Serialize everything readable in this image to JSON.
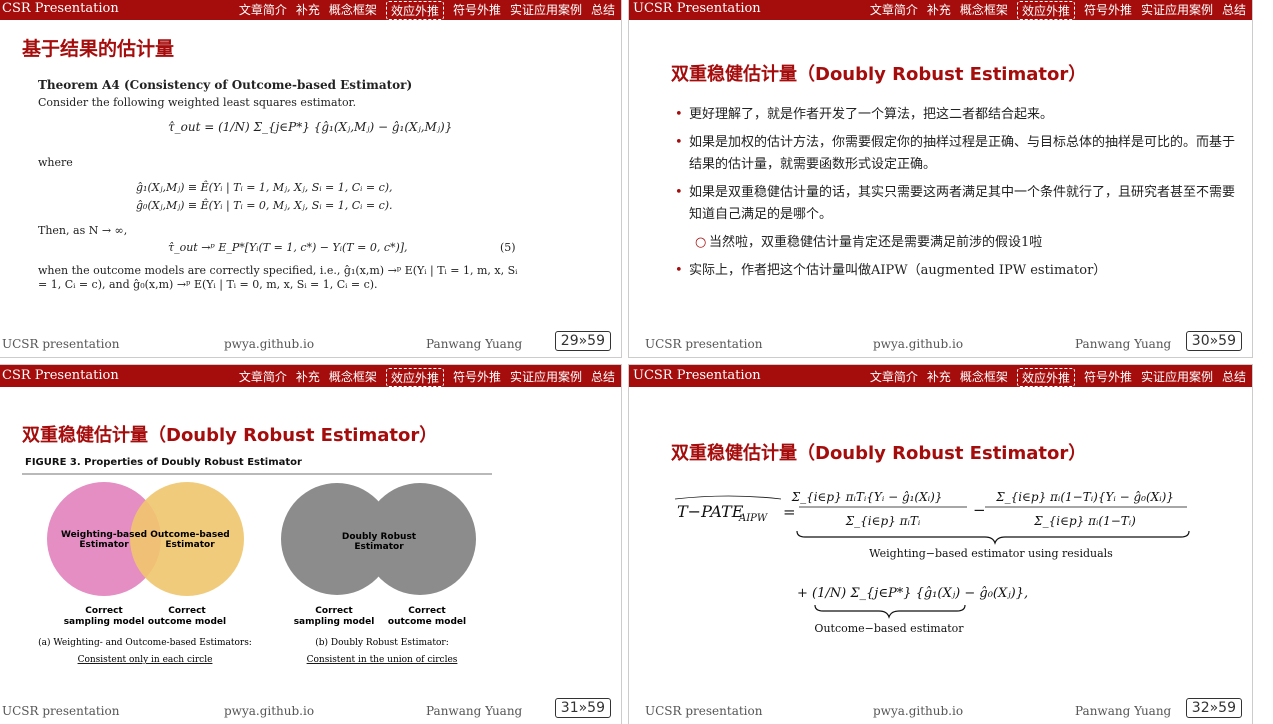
{
  "common": {
    "brand": "UCSR Presentation",
    "nav": [
      "文章简介",
      "补充",
      "概念框架",
      "效应外推",
      "符号外推",
      "实证应用案例",
      "总结"
    ],
    "footer_left": "UCSR presentation",
    "footer_mid": "pwya.github.io",
    "footer_right": "Panwang Yuang"
  },
  "s29": {
    "brand": "CSR Presentation",
    "footer_left": "UCSR presentation",
    "page": "29»59",
    "title": "基于结果的估计量",
    "theorem": "Theorem A4 (Consistency of Outcome-based Estimator)",
    "intro": "Consider the following weighted least squares estimator.",
    "eq1": "τ̂_out = (1/N) Σ_{j∈P*} {ĝ₁(Xⱼ,Mⱼ) − ĝ₁(Xⱼ,Mⱼ)}",
    "where": "where",
    "eq2a": "ĝ₁(Xⱼ,Mⱼ) ≡ Ê(Yᵢ | Tᵢ = 1, Mⱼ, Xⱼ, Sᵢ = 1, Cᵢ = c),",
    "eq2b": "ĝ₀(Xⱼ,Mⱼ) ≡ Ê(Yᵢ | Tᵢ = 0, Mⱼ, Xⱼ, Sᵢ = 1, Cᵢ = c).",
    "then": "Then, as N → ∞,",
    "eq3": "τ̂_out →ᵖ E_P*[Yᵢ(T = 1, c*) − Yᵢ(T = 0, c*)],",
    "eq3num": "(5)",
    "cond": "when the outcome models are correctly specified, i.e., ĝ₁(x,m) →ᵖ E(Yᵢ | Tᵢ = 1, m, x, Sᵢ = 1, Cᵢ = c), and ĝ₀(x,m) →ᵖ E(Yᵢ | Tᵢ = 0, m, x, Sᵢ = 1, Cᵢ = c)."
  },
  "s30": {
    "page": "30»59",
    "title": "双重稳健估计量（Doubly Robust Estimator）",
    "bullets": [
      "更好理解了，就是作者开发了一个算法，把这二者都结合起来。",
      "如果是加权的估计方法，你需要假定你的抽样过程是正确、与目标总体的抽样是可比的。而基于结果的估计量，就需要函数形式设定正确。",
      "如果是双重稳健估计量的话，其实只需要这两者满足其中一个条件就行了，且研究者甚至不需要知道自己满足的是哪个。",
      "当然啦，双重稳健估计量肯定还是需要满足前涉的假设1啦",
      "实际上，作者把这个估计量叫做AIPW（augmented IPW estimator）"
    ]
  },
  "s31": {
    "brand": "CSR Presentation",
    "footer_left": "UCSR presentation",
    "page": "31»59",
    "title": "双重稳健估计量（Doubly Robust Estimator）",
    "fig_title": "FIGURE 3.   Properties of Doubly Robust Estimator",
    "left_circle_a": "Weighting-based Estimator",
    "left_circle_b": "Outcome-based Estimator",
    "right_circle": "Doubly Robust Estimator",
    "lab_a1": "Correct",
    "lab_a2": "sampling model",
    "lab_b1": "Correct",
    "lab_b2": "outcome model",
    "cap_a": "(a) Weighting- and Outcome-based Estimators:",
    "cap_a2": "Consistent only in each circle",
    "cap_b": "(b) Doubly Robust Estimator:",
    "cap_b2": "Consistent in the union of circles",
    "color_pink": "#e48ec4",
    "color_gold": "#efc56e",
    "color_gray": "#8c8c8c"
  },
  "s32": {
    "page": "32»59",
    "title": "双重稳健估计量（Doubly Robust Estimator）",
    "lhs": "T−PATE",
    "lhs_sub": "AIPW",
    "num1": "Σ_{i∈p} πᵢTᵢ{Yᵢ − ĝ₁(Xᵢ)}",
    "den1": "Σ_{i∈p} πᵢTᵢ",
    "num2": "Σ_{i∈p} πᵢ(1−Tᵢ){Yᵢ − ĝ₀(Xᵢ)}",
    "den2": "Σ_{i∈p} πᵢ(1−Tᵢ)",
    "brace1": "Weighting−based estimator using residuals",
    "term2": "+ (1/N) Σ_{j∈P*} {ĝ₁(Xⱼ) − ĝ₀(Xⱼ)},",
    "brace2": "Outcome−based estimator"
  }
}
